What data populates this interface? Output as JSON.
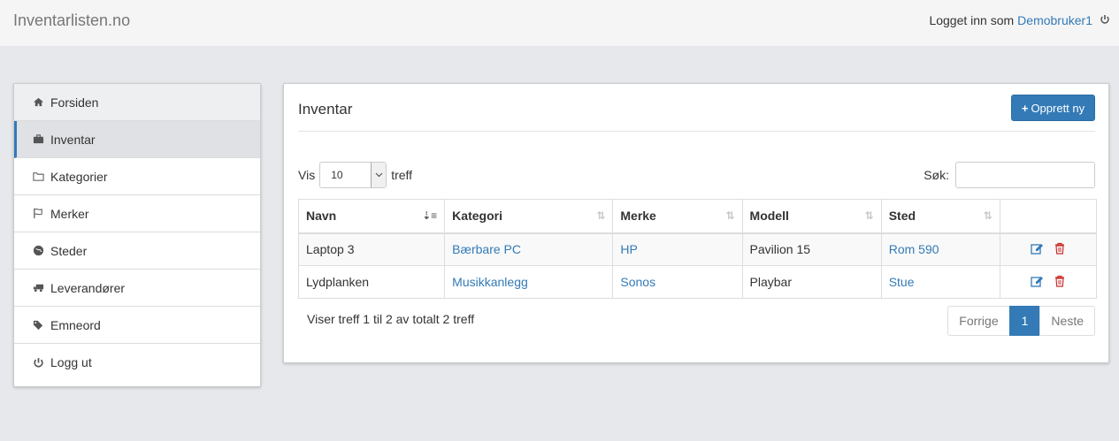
{
  "header": {
    "brand": "Inventarlisten.no",
    "logged_in_prefix": "Logget inn som",
    "username": "Demobruker1"
  },
  "sidebar": {
    "items": [
      {
        "label": "Forsiden",
        "icon": "home-icon"
      },
      {
        "label": "Inventar",
        "icon": "briefcase-icon",
        "active": true
      },
      {
        "label": "Kategorier",
        "icon": "folder-icon"
      },
      {
        "label": "Merker",
        "icon": "flag-icon"
      },
      {
        "label": "Steder",
        "icon": "globe-icon"
      },
      {
        "label": "Leverandører",
        "icon": "truck-icon"
      },
      {
        "label": "Emneord",
        "icon": "tags-icon"
      },
      {
        "label": "Logg ut",
        "icon": "power-icon"
      }
    ]
  },
  "main": {
    "title": "Inventar",
    "create_button": "Opprett ny",
    "length": {
      "prefix": "Vis",
      "value": "10",
      "suffix": "treff"
    },
    "search": {
      "label": "Søk:",
      "value": ""
    },
    "columns": [
      "Navn",
      "Kategori",
      "Merke",
      "Modell",
      "Sted"
    ],
    "rows": [
      {
        "navn": "Laptop 3",
        "kategori": "Bærbare PC",
        "merke": "HP",
        "modell": "Pavilion 15",
        "sted": "Rom 590"
      },
      {
        "navn": "Lydplanken",
        "kategori": "Musikkanlegg",
        "merke": "Sonos",
        "modell": "Playbar",
        "sted": "Stue"
      }
    ],
    "info": "Viser treff 1 til 2 av totalt 2 treff",
    "pagination": {
      "prev": "Forrige",
      "current": "1",
      "next": "Neste"
    }
  },
  "colors": {
    "accent": "#337ab7",
    "danger": "#c9302c"
  }
}
